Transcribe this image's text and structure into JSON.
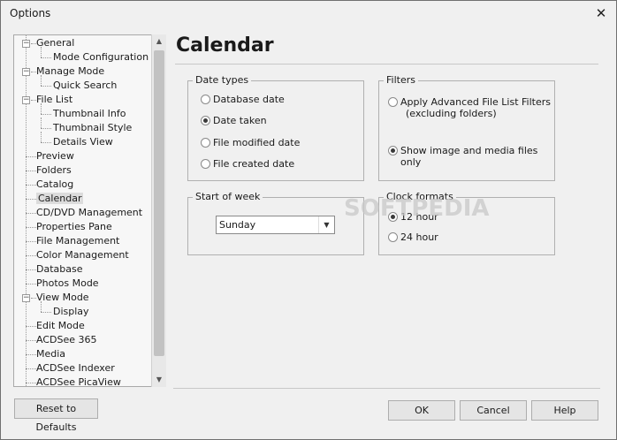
{
  "window": {
    "title": "Options",
    "close_glyph": "✕"
  },
  "tree": {
    "items": [
      {
        "label": "General",
        "level": 0,
        "expanded": true
      },
      {
        "label": "Mode Configuration",
        "level": 1
      },
      {
        "label": "Manage Mode",
        "level": 0,
        "expanded": true
      },
      {
        "label": "Quick Search",
        "level": 1
      },
      {
        "label": "File List",
        "level": 0,
        "expanded": true
      },
      {
        "label": "Thumbnail Info",
        "level": 1
      },
      {
        "label": "Thumbnail Style",
        "level": 1
      },
      {
        "label": "Details View",
        "level": 1
      },
      {
        "label": "Preview",
        "level": 0
      },
      {
        "label": "Folders",
        "level": 0
      },
      {
        "label": "Catalog",
        "level": 0
      },
      {
        "label": "Calendar",
        "level": 0,
        "selected": true
      },
      {
        "label": "CD/DVD Management",
        "level": 0
      },
      {
        "label": "Properties Pane",
        "level": 0
      },
      {
        "label": "File Management",
        "level": 0
      },
      {
        "label": "Color Management",
        "level": 0
      },
      {
        "label": "Database",
        "level": 0
      },
      {
        "label": "Photos Mode",
        "level": 0
      },
      {
        "label": "View Mode",
        "level": 0,
        "expanded": true
      },
      {
        "label": "Display",
        "level": 1
      },
      {
        "label": "Edit Mode",
        "level": 0
      },
      {
        "label": "ACDSee 365",
        "level": 0
      },
      {
        "label": "Media",
        "level": 0
      },
      {
        "label": "ACDSee Indexer",
        "level": 0
      },
      {
        "label": "ACDSee PicaView",
        "level": 0
      }
    ]
  },
  "page": {
    "heading": "Calendar"
  },
  "date_types": {
    "label": "Date types",
    "options": [
      {
        "label": "Database date",
        "checked": false
      },
      {
        "label": "Date taken",
        "checked": true
      },
      {
        "label": "File modified date",
        "checked": false
      },
      {
        "label": "File created date",
        "checked": false
      }
    ]
  },
  "filters": {
    "label": "Filters",
    "options": [
      {
        "label": "Apply Advanced File List Filters",
        "label2": "(excluding folders)",
        "checked": false
      },
      {
        "label": "Show image and media files only",
        "checked": true
      }
    ]
  },
  "start_of_week": {
    "label": "Start of week",
    "value": "Sunday"
  },
  "clock_formats": {
    "label": "Clock formats",
    "options": [
      {
        "label": "12 hour",
        "checked": true
      },
      {
        "label": "24 hour",
        "checked": false
      }
    ]
  },
  "watermark": "SOFTPEDIA",
  "buttons": {
    "reset": "Reset to Defaults",
    "ok": "OK",
    "cancel": "Cancel",
    "help": "Help"
  }
}
